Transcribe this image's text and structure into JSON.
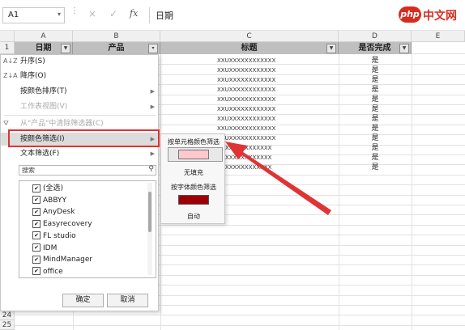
{
  "formula_bar": {
    "name_box": "A1",
    "name_box_dropdown_icon": "chevron-down",
    "cancel_icon": "×",
    "enter_icon": "✓",
    "fx_label": "fx",
    "content": "日期"
  },
  "watermark": {
    "php": "php",
    "cn": "中文网"
  },
  "columns": [
    "A",
    "B",
    "C",
    "D",
    "E"
  ],
  "header_row": {
    "row_num": "1",
    "date": "日期",
    "product": "产品",
    "title": "标题",
    "done": "是否完成"
  },
  "data_rows": {
    "titles": [
      "XXUXXXXXXXXXXXX",
      "XXUXXXXXXXXXXXX",
      "XXUXXXXXXXXXXXX",
      "XXUXXXXXXXXXXXX",
      "XXUXXXXXXXXXXXX",
      "XXUXXXXXXXXXXXX",
      "XXUXXXXXXXXXXXX",
      "XXUXXXXXXXXXXXX",
      "XXUXXXXXXXXXXXX",
      "UXXXXXXXXXXXXX",
      "UXXXXXXXXXXXXX",
      "UXXXXXXXXXXXXX"
    ],
    "done": [
      "是",
      "是",
      "是",
      "是",
      "是",
      "是",
      "是",
      "是",
      "是",
      "是",
      "是",
      "是"
    ]
  },
  "bottom_rows": [
    "24",
    "25"
  ],
  "menu": {
    "sort_asc": "升序(S)",
    "sort_desc": "降序(O)",
    "sort_by_color": "按颜色排序(T)",
    "sheet_view": "工作表视图(V)",
    "clear_filter": "从\"产品\"中清除筛选器(C)",
    "filter_by_color": "按颜色筛选(I)",
    "text_filter": "文本筛选(F)",
    "search_placeholder": "搜索",
    "items": [
      "(全选)",
      "ABBYY",
      "AnyDesk",
      "Easyrecovery",
      "FL studio",
      "IDM",
      "MindManager",
      "office",
      "..."
    ],
    "ok": "确定",
    "cancel": "取消"
  },
  "submenu": {
    "by_cell_color": "按单元格颜色筛选",
    "no_fill": "无填充",
    "by_font_color": "按字体颜色筛选",
    "automatic": "自动"
  },
  "colors": {
    "highlight_box": "#e03434",
    "arrow": "#e03434",
    "cell_fill_swatch": "#ffc7ce",
    "font_color_swatch": "#9c0006",
    "header_fill": "#bfbfbf"
  }
}
